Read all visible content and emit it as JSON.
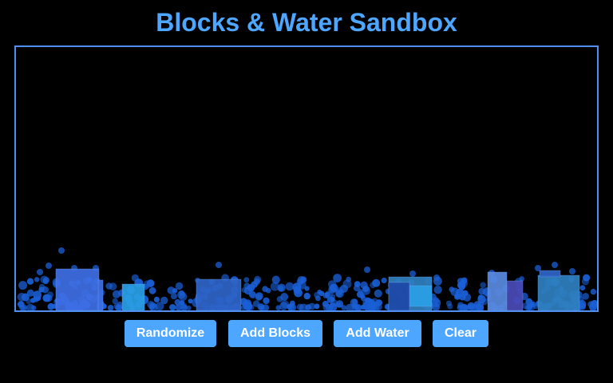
{
  "app": {
    "title": "Blocks & Water Sandbox"
  },
  "controls": {
    "randomize_label": "Randomize",
    "add_blocks_label": "Add Blocks",
    "add_water_label": "Add Water",
    "clear_label": "Clear"
  },
  "colors": {
    "accent": "#4da6ff",
    "title": "#4da6ff",
    "border": "#4f8ff0",
    "background": "#000000",
    "water": "#1a5fd6",
    "block_palette": [
      "#3f6fe6",
      "#2aa0e6",
      "#2e64c8",
      "#2f80c0",
      "#5a8ae0",
      "#4a4ab8",
      "#1f48a8"
    ]
  }
}
